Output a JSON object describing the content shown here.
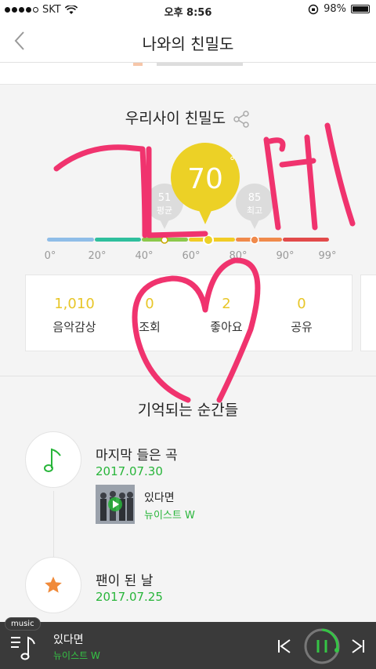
{
  "status_bar": {
    "carrier": "SKT",
    "time": "오후 8:56",
    "battery": "98%"
  },
  "nav": {
    "title": "나와의 친밀도"
  },
  "intimacy": {
    "section_title": "우리사이 친밀도",
    "score": "70",
    "score_unit": "°",
    "average_value": "51",
    "average_label": "평균",
    "max_value": "85",
    "max_label": "최고",
    "scale_labels": [
      "0°",
      "20°",
      "40°",
      "60°",
      "80°",
      "90°",
      "99°"
    ],
    "bar_colors": [
      "#8fbde8",
      "#2fbf9d",
      "#8cc84b",
      "#f1cc25",
      "#f08a4b",
      "#e24a4a"
    ]
  },
  "stats": [
    {
      "value": "1,010",
      "label": "음악감상"
    },
    {
      "value": "0",
      "label": "조회"
    },
    {
      "value": "2",
      "label": "좋아요"
    },
    {
      "value": "0",
      "label": "공유"
    }
  ],
  "memories": {
    "section_title": "기억되는 순간들",
    "items": [
      {
        "icon": "music-note-icon",
        "title": "마지막 들은 곡",
        "date": "2017.07.30",
        "song_title": "있다면",
        "song_artist": "뉴이스트 W"
      },
      {
        "icon": "star-icon",
        "title": "팬이 된 날",
        "date": "2017.07.25"
      }
    ]
  },
  "player": {
    "tag": "music",
    "title": "있다면",
    "artist": "뉴이스트 W"
  },
  "colors": {
    "accent_green": "#28b53a",
    "score_yellow": "#ecd126",
    "handwriting_pink": "#f0336e"
  }
}
